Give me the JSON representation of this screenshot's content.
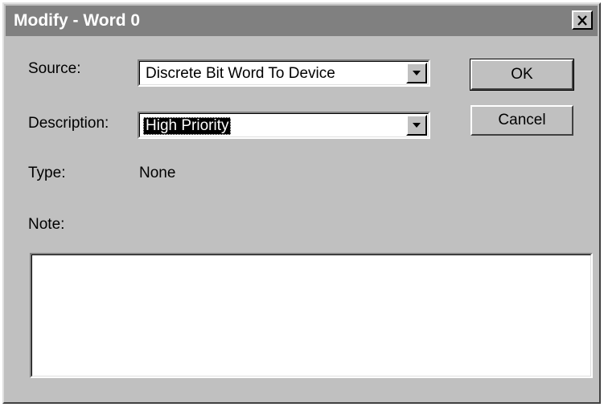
{
  "window": {
    "title": "Modify - Word 0",
    "close_icon": "close-icon"
  },
  "form": {
    "source_label": "Source:",
    "source_value": "Discrete Bit Word To Device",
    "description_label": "Description:",
    "description_value": "High Priority",
    "type_label": "Type:",
    "type_value": "None",
    "note_label": "Note:",
    "note_value": ""
  },
  "buttons": {
    "ok_label": "OK",
    "cancel_label": "Cancel"
  },
  "colors": {
    "face": "#c0c0c0",
    "titlebar_inactive": "#808080",
    "highlight": "#000000"
  }
}
